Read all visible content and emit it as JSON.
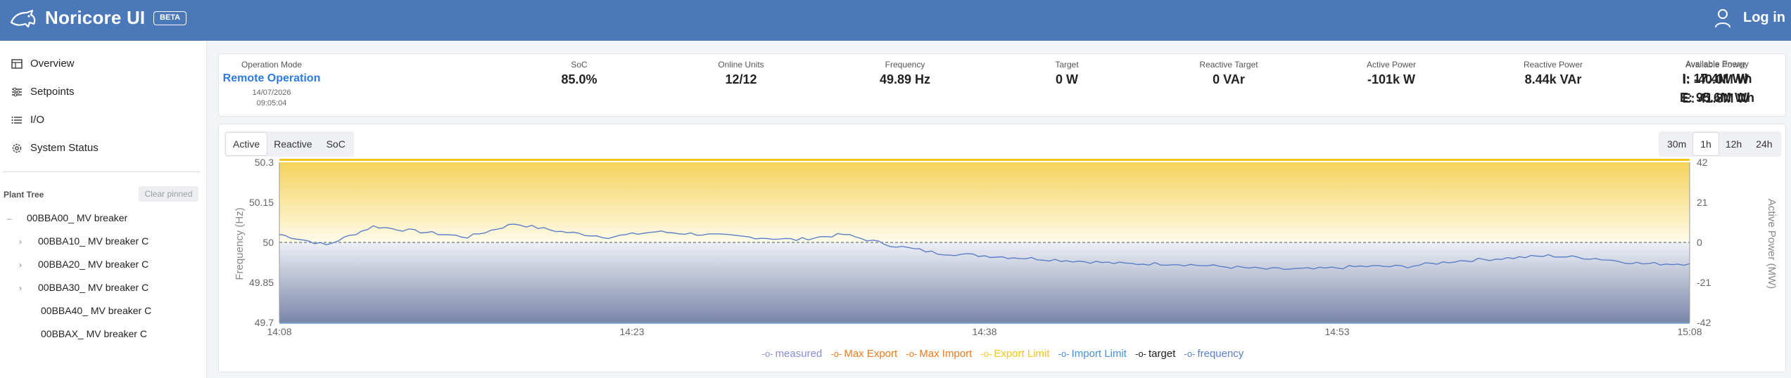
{
  "app": {
    "brand": "Noricore UI",
    "badge": "BETA",
    "login_label": "Log in"
  },
  "sidebar": {
    "nav": [
      {
        "label": "Overview",
        "icon": "table-icon"
      },
      {
        "label": "Setpoints",
        "icon": "sliders-icon"
      },
      {
        "label": "I/O",
        "icon": "list-icon"
      },
      {
        "label": "System Status",
        "icon": "gear-icon"
      }
    ],
    "tree_title": "Plant Tree",
    "clear_pinned": "Clear pinned",
    "tree": [
      {
        "label": "00BBA00_ MV breaker",
        "level": 0,
        "toggle": "–"
      },
      {
        "label": "00BBA10_ MV breaker C",
        "level": 1,
        "toggle": "›"
      },
      {
        "label": "00BBA20_ MV breaker C",
        "level": 1,
        "toggle": "›"
      },
      {
        "label": "00BBA30_ MV breaker C",
        "level": 1,
        "toggle": "›"
      },
      {
        "label": "00BBA40_ MV breaker C",
        "level": 1,
        "toggle": ""
      },
      {
        "label": "00BBAX_ MV breaker C",
        "level": 1,
        "toggle": ""
      }
    ]
  },
  "stats": {
    "operation_mode": {
      "label": "Operation Mode",
      "value": "Remote Operation",
      "date": "14/07/2026",
      "time": "09:05:04"
    },
    "soc": {
      "label": "SoC",
      "value": "85.0%"
    },
    "online_units": {
      "label": "Online Units",
      "value": "12/12"
    },
    "frequency": {
      "label": "Frequency",
      "value": "49.89 Hz"
    },
    "target": {
      "label": "Target",
      "value": "0 W"
    },
    "reactive_target": {
      "label": "Reactive Target",
      "value": "0 VAr"
    },
    "active_power": {
      "label": "Active Power",
      "value": "-101k W"
    },
    "reactive_power": {
      "label": "Reactive Power",
      "value": "8.44k VAr"
    },
    "available_power": {
      "label": "Available Power",
      "import": "I: -40.0M W",
      "export": "E: 41.8M W"
    },
    "available_energy": {
      "label": "Available Energy",
      "import": "I: 17.4M Wh",
      "export": "E: 95.6M Wh"
    }
  },
  "chart_tabs": [
    {
      "label": "Active",
      "active": true
    },
    {
      "label": "Reactive",
      "active": false
    },
    {
      "label": "SoC",
      "active": false
    }
  ],
  "range_buttons": [
    {
      "label": "30m",
      "active": false
    },
    {
      "label": "1h",
      "active": true
    },
    {
      "label": "12h",
      "active": false
    },
    {
      "label": "24h",
      "active": false
    }
  ],
  "colors": {
    "header": "#4b78b8",
    "measured": "#8a8fd0",
    "max_export": "#f07b1e",
    "max_import": "#f07b1e",
    "export_limit": "#f5c518",
    "import_limit": "#4a90d9",
    "target": "#222222",
    "frequency": "#5b7fc7"
  },
  "chart_data": {
    "type": "line",
    "xlabel": "",
    "ylabel_left": "Frequency (Hz)",
    "ylabel_right": "Active Power (MW)",
    "x_ticks": [
      "14:08",
      "14:23",
      "14:38",
      "14:53",
      "15:08"
    ],
    "y_left_ticks": [
      "50.3",
      "50.15",
      "50",
      "49.85",
      "49.7"
    ],
    "y_right_ticks": [
      "42",
      "21",
      "0",
      "-21",
      "-42"
    ],
    "ylim_left": [
      49.7,
      50.3
    ],
    "ylim_right": [
      -42,
      42
    ],
    "legend": [
      "measured",
      "Max Export",
      "Max Import",
      "Export Limit",
      "Import Limit",
      "target",
      "frequency"
    ],
    "series": [
      {
        "name": "frequency",
        "x": [
          "14:08",
          "14:10",
          "14:12",
          "14:14",
          "14:16",
          "14:18",
          "14:20",
          "14:22",
          "14:24",
          "14:26",
          "14:28",
          "14:30",
          "14:32",
          "14:34",
          "14:36",
          "14:38",
          "14:40",
          "14:42",
          "14:44",
          "14:46",
          "14:48",
          "14:50",
          "14:52",
          "14:54",
          "14:56",
          "14:58",
          "15:00",
          "15:02",
          "15:04",
          "15:06",
          "15:08"
        ],
        "values": [
          50.03,
          49.99,
          50.06,
          50.04,
          50.02,
          50.07,
          50.04,
          50.02,
          50.04,
          50.03,
          50.02,
          50.01,
          50.03,
          49.99,
          49.96,
          49.95,
          49.94,
          49.93,
          49.92,
          49.92,
          49.91,
          49.9,
          49.9,
          49.91,
          49.91,
          49.93,
          49.94,
          49.95,
          49.94,
          49.92,
          49.92
        ]
      },
      {
        "name": "Export Limit",
        "values": [
          41.8
        ]
      },
      {
        "name": "Import Limit",
        "values": [
          -40.0
        ]
      },
      {
        "name": "target",
        "values": [
          0
        ]
      }
    ]
  }
}
